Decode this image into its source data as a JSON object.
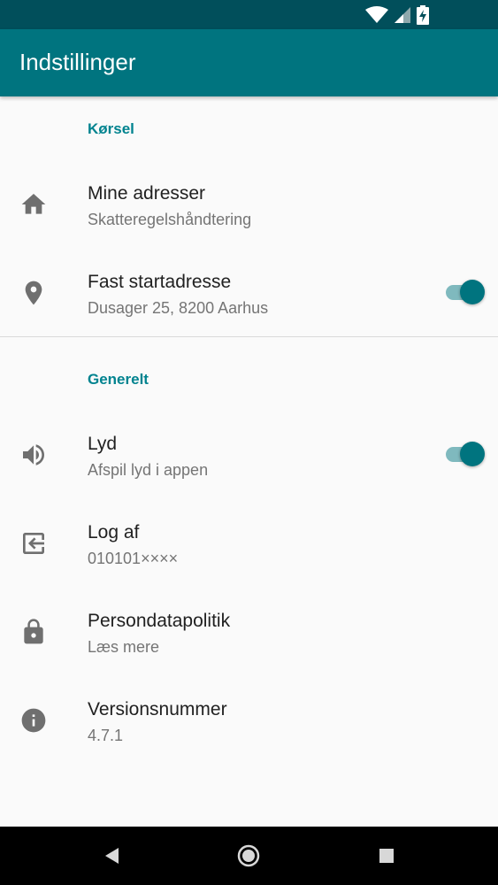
{
  "app_bar": {
    "title": "Indstillinger"
  },
  "sections": {
    "driving": {
      "header": "Kørsel",
      "items": [
        {
          "title": "Mine adresser",
          "subtitle": "Skatteregelshåndtering",
          "icon": "home-icon"
        },
        {
          "title": "Fast startadresse",
          "subtitle": "Dusager 25, 8200 Aarhus",
          "icon": "location-pin-icon",
          "toggle_on": true
        }
      ]
    },
    "general": {
      "header": "Generelt",
      "items": [
        {
          "title": "Lyd",
          "subtitle": "Afspil lyd i appen",
          "icon": "volume-icon",
          "toggle_on": true
        },
        {
          "title": "Log af",
          "subtitle": "010101××××",
          "icon": "logout-icon"
        },
        {
          "title": "Persondatapolitik",
          "subtitle": "Læs mere",
          "icon": "lock-icon"
        },
        {
          "title": "Versionsnummer",
          "subtitle": "4.7.1",
          "icon": "info-icon"
        }
      ]
    }
  },
  "nav_bar": {
    "buttons": [
      "back-icon",
      "home-circle-icon",
      "recents-icon"
    ]
  },
  "colors": {
    "status_bar": "#014f5b",
    "app_bar": "#00747f",
    "accent": "#00838f",
    "toggle_thumb": "#00747f",
    "toggle_track": "#7fb9be"
  }
}
